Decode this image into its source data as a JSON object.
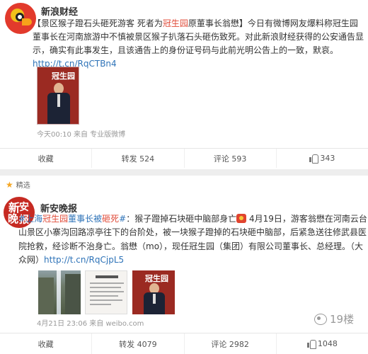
{
  "post1": {
    "author": "新浪财经",
    "text_bracket_open": "【",
    "text_title_a": "景区猴子蹬石头砸死游客 死者为",
    "text_title_hl": "冠生园",
    "text_title_b": "原董事长翁懋",
    "text_bracket_close": "】",
    "text_body": "今日有微博网友爆料称冠生园董事长在河南旅游中不慎被景区猴子扒落石头砸伤致死。对此新浪财经获得的公安通告显示，确实有此事发生，且该通告上的身份证号码与此前光明公告上的一致，默哀。",
    "link": "http://t.cn/RqCTBn4",
    "photo_title": "冠生园",
    "meta": "今天00:10 来自 专业版微博",
    "actions": {
      "collect": "收藏",
      "repost": "转发 524",
      "comment": "评论 593",
      "like": "343"
    }
  },
  "post2": {
    "featured_label": "精选",
    "author": "新安晚报",
    "avatar_chars": [
      "新",
      "安",
      "晚",
      "报"
    ],
    "tag_open": "#",
    "tag_a": "上海",
    "tag_hl1": "冠生园",
    "tag_b": "董事长被",
    "tag_hl2": "砸死",
    "tag_close": "#",
    "text_lead": "：猴子蹬掉石块砸中脑部身亡",
    "text_body": " 4月19日，游客翁懋在河南云台山景区小寨沟回路凉亭往下的台阶处，被一块猴子蹬掉的石块砸中脑部，后紧急送往修武县医院抢救，经诊断不治身亡。翁懋（mo），现任冠生园（集团）有限公司董事长、总经理。（大众网）",
    "link": "http://t.cn/RqCjpL5",
    "photo_title": "冠生园",
    "meta": "4月21日 23:06 来自 weibo.com",
    "actions": {
      "collect": "收藏",
      "repost": "转发 4079",
      "comment": "评论 2982",
      "like": "1048"
    }
  },
  "watermark": "19楼",
  "colors": {
    "highlight": "#e04c3a",
    "link": "#2e73b8",
    "meta": "#999999"
  }
}
